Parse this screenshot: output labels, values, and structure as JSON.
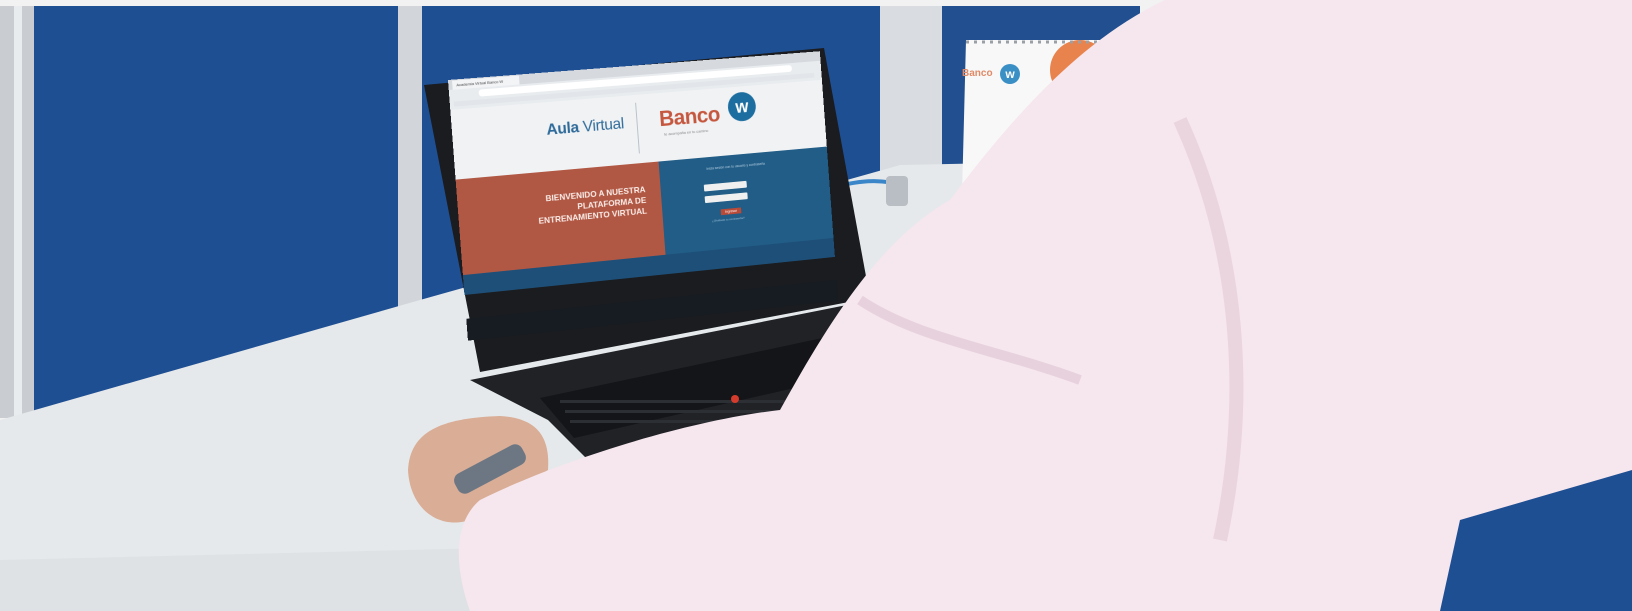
{
  "screen": {
    "tab_title": "Academia Virtual Banco W",
    "aula_title_bold": "Aula",
    "aula_title_rest": " Virtual",
    "brand_name": "Banco",
    "brand_logo_letter": "w",
    "brand_tagline": "te acompaña en tu camino",
    "welcome_text": "BIENVENIDO A NUESTRA PLATAFORMA DE ENTRENAMIENTO VIRTUAL",
    "login_hint": "Inicia sesión con tu usuario y contraseña",
    "login_button": "Ingresar",
    "forgot_link": "¿Olvidaste tu contraseña?"
  },
  "calendar": {
    "brand_name": "Banco",
    "brand_logo_letter": "w"
  },
  "colors": {
    "wall_blue": "#1f4f93",
    "desk": "#e6e9eb",
    "shirt": "#f6e6ee",
    "welcome_panel": "#b15844",
    "login_panel": "#215d86",
    "brand_red": "#c6573f",
    "brand_blue": "#1d6ea0"
  }
}
